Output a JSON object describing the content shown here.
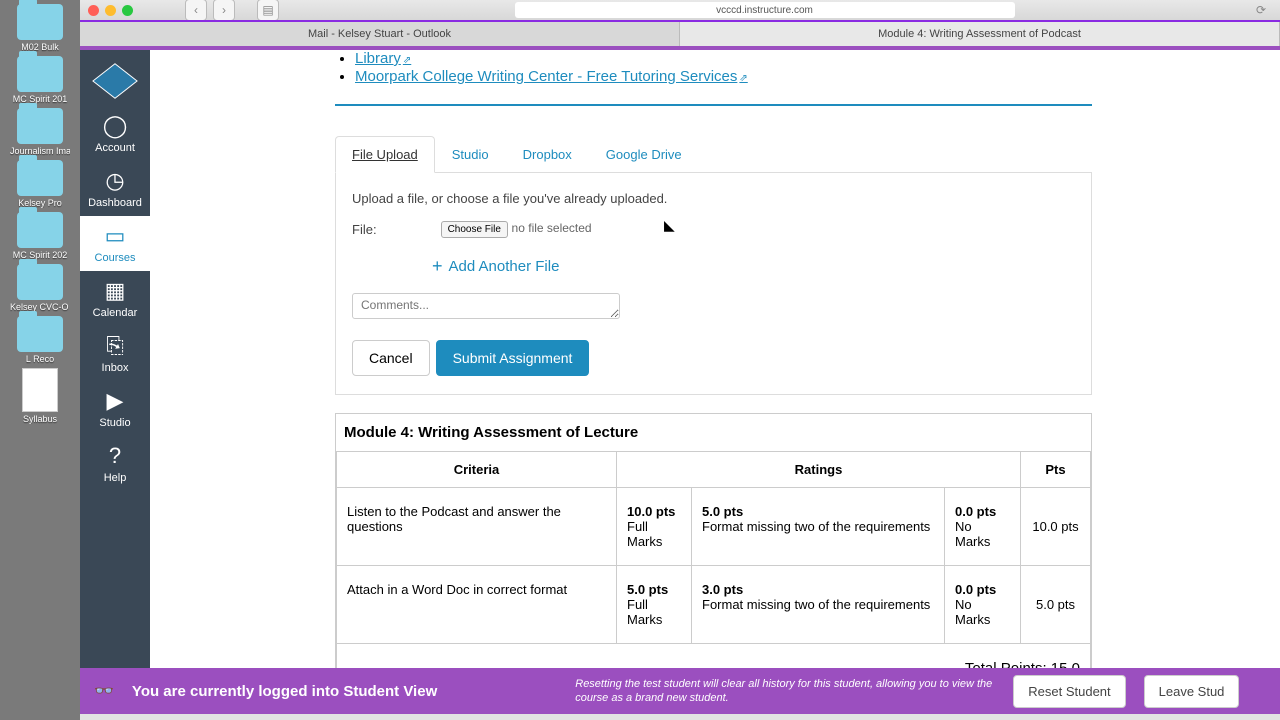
{
  "browser": {
    "url": "vcccd.instructure.com"
  },
  "tabs": [
    {
      "label": "Mail - Kelsey Stuart - Outlook"
    },
    {
      "label": "Module 4: Writing Assessment of Podcast"
    }
  ],
  "desktop": {
    "folders": [
      {
        "label": "M02 Bulk"
      },
      {
        "label": "MC Spirit 201"
      },
      {
        "label": "Journalism Images"
      },
      {
        "label": "Kelsey Pro"
      },
      {
        "label": "MC Spirit 202"
      },
      {
        "label": "Kelsey CVC-O Grant"
      },
      {
        "label": "L Reco"
      }
    ],
    "doc": "Syllabus"
  },
  "sidebar": {
    "items": [
      {
        "label": "Account"
      },
      {
        "label": "Dashboard"
      },
      {
        "label": "Courses"
      },
      {
        "label": "Calendar"
      },
      {
        "label": "Inbox"
      },
      {
        "label": "Studio"
      },
      {
        "label": "Help"
      }
    ]
  },
  "links": [
    {
      "text": "Library"
    },
    {
      "text": "Moorpark College Writing Center - Free Tutoring Services"
    }
  ],
  "upload": {
    "tabs": [
      "File Upload",
      "Studio",
      "Dropbox",
      "Google Drive"
    ],
    "hint": "Upload a file, or choose a file you've already uploaded.",
    "file_label": "File:",
    "choose": "Choose File",
    "no_file": "no file selected",
    "add_another": "Add Another File",
    "comments_ph": "Comments...",
    "cancel": "Cancel",
    "submit": "Submit Assignment"
  },
  "rubric": {
    "title": "Module 4: Writing Assessment of Lecture",
    "headers": {
      "criteria": "Criteria",
      "ratings": "Ratings",
      "pts": "Pts"
    },
    "rows": [
      {
        "criterion": "Listen to the Podcast and answer the questions",
        "ratings": [
          {
            "pts": "10.0 pts",
            "label": "Full Marks"
          },
          {
            "pts": "5.0 pts",
            "label": "Format missing two of the requirements"
          },
          {
            "pts": "0.0 pts",
            "label": "No Marks"
          }
        ],
        "total": "10.0 pts"
      },
      {
        "criterion": "Attach in a Word Doc in correct format",
        "ratings": [
          {
            "pts": "5.0 pts",
            "label": "Full Marks"
          },
          {
            "pts": "3.0 pts",
            "label": "Format missing two of the requirements"
          },
          {
            "pts": "0.0 pts",
            "label": "No Marks"
          }
        ],
        "total": "5.0 pts"
      }
    ],
    "total": "Total Points: 15.0"
  },
  "student_view": {
    "text": "You are currently logged into Student View",
    "desc": "Resetting the test student will clear all history for this student, allowing you to view the course as a brand new student.",
    "reset": "Reset Student",
    "leave": "Leave Stud"
  }
}
